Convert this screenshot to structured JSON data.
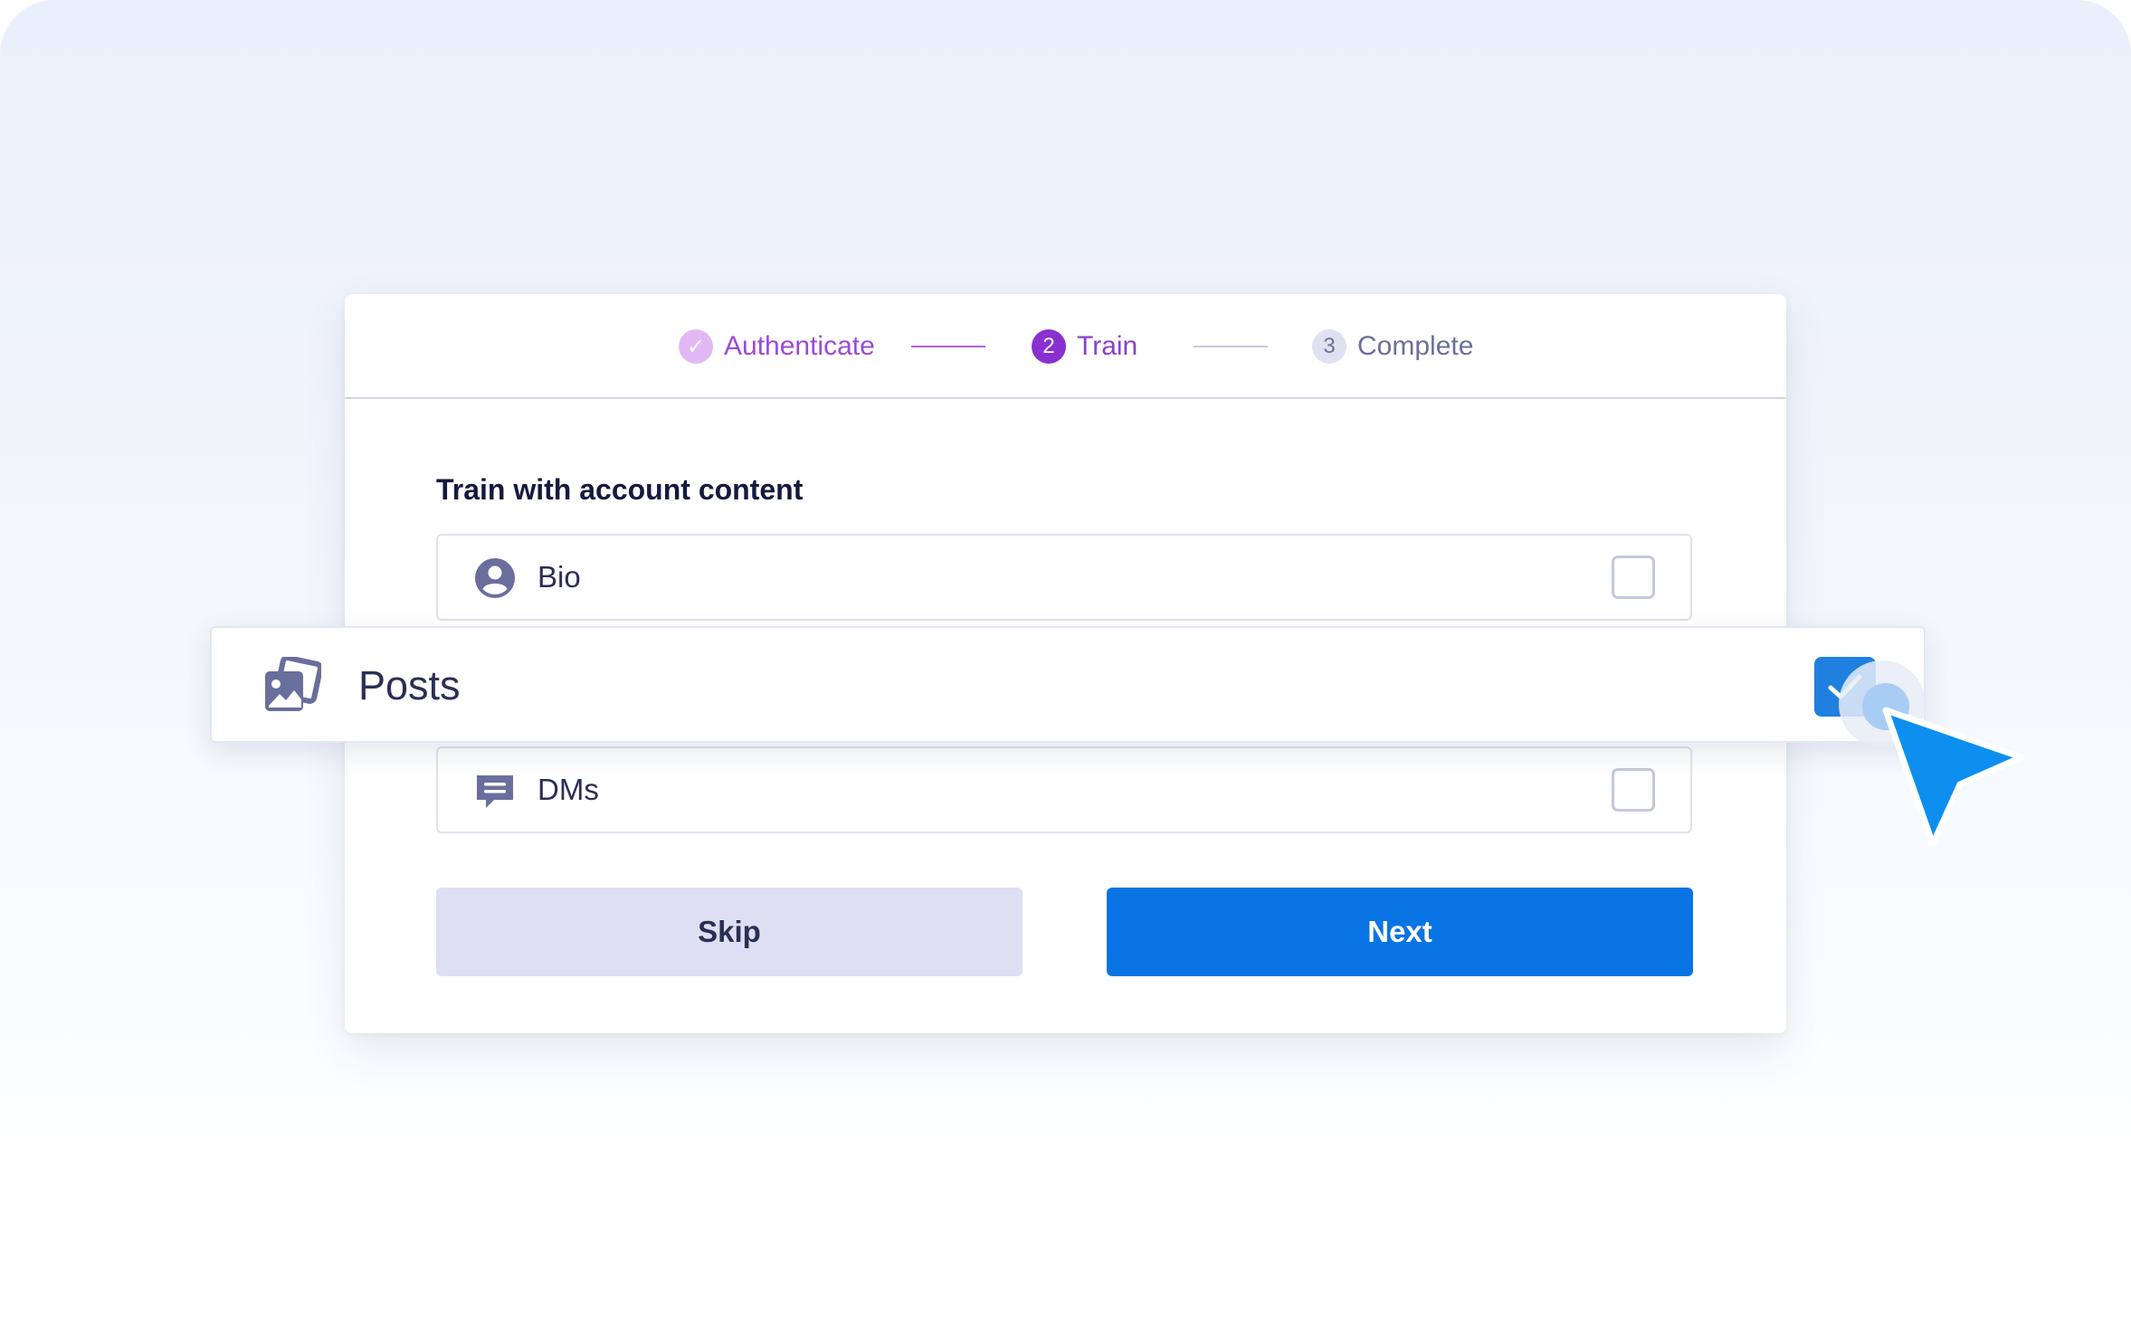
{
  "stepper": {
    "steps": [
      {
        "label": "Authenticate",
        "badge": "✓",
        "state": "completed"
      },
      {
        "label": "Train",
        "badge": "2",
        "state": "active"
      },
      {
        "label": "Complete",
        "badge": "3",
        "state": "upcoming"
      }
    ]
  },
  "section": {
    "title": "Train with account content"
  },
  "options": {
    "bio": {
      "label": "Bio",
      "checked": false,
      "icon": "user-circle-icon"
    },
    "posts": {
      "label": "Posts",
      "checked": true,
      "icon": "images-icon"
    },
    "dms": {
      "label": "DMs",
      "checked": false,
      "icon": "message-icon"
    }
  },
  "actions": {
    "skip_label": "Skip",
    "next_label": "Next"
  },
  "colors": {
    "primary": "#0874e3",
    "accent_purple": "#8a2fd0",
    "checkbox_checked": "#1f80e0",
    "cursor": "#0c8fee"
  }
}
